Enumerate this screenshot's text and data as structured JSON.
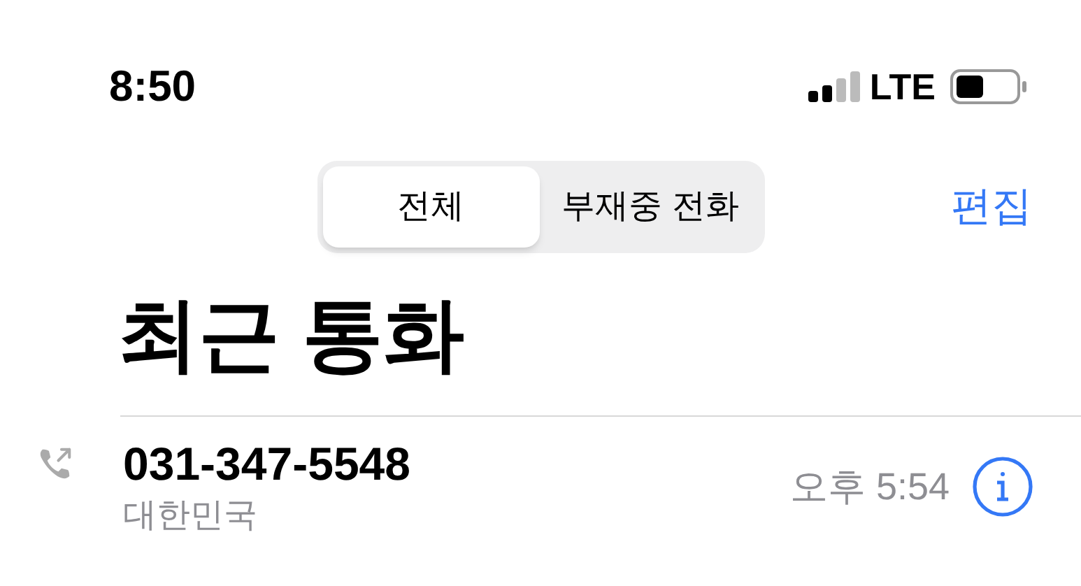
{
  "status_bar": {
    "time": "8:50",
    "network": "LTE"
  },
  "segments": [
    {
      "label": "전체",
      "selected": true
    },
    {
      "label": "부재중 전화",
      "selected": false
    }
  ],
  "edit_button": "편집",
  "title": "최근 통화",
  "calls": [
    {
      "number": "031-347-5548",
      "missed": false,
      "location": "대한민국",
      "time": "오후 5:54"
    }
  ]
}
